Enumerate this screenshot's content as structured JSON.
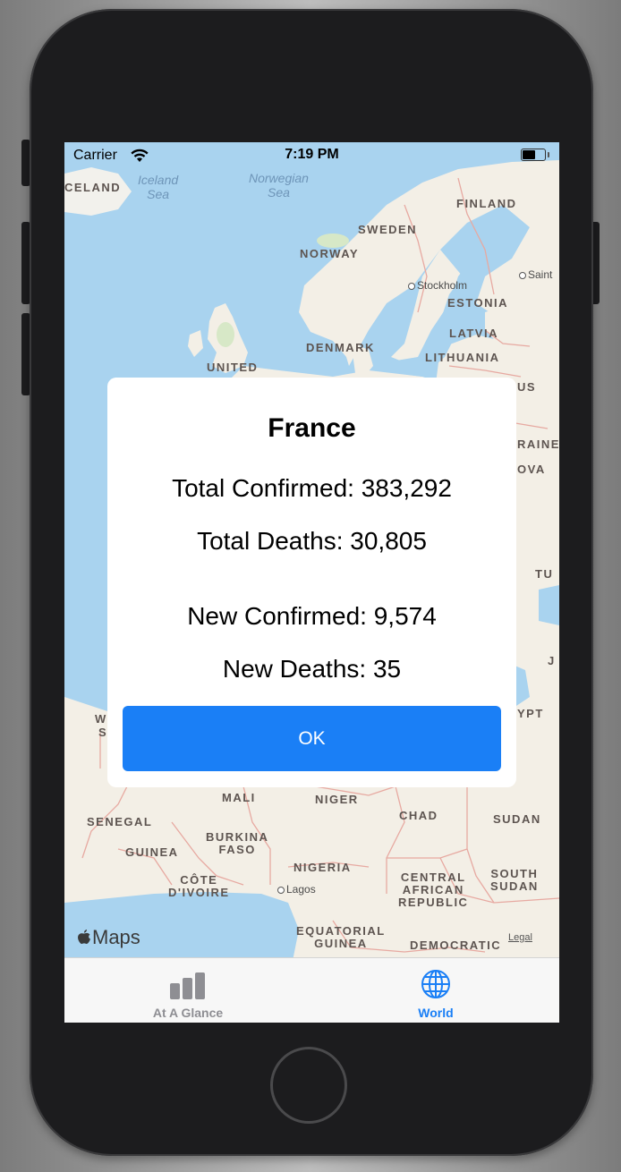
{
  "status_bar": {
    "carrier": "Carrier",
    "time": "7:19 PM"
  },
  "map": {
    "attribution": "Maps",
    "legal": "Legal",
    "labels": {
      "iceland": "CELAND",
      "finland": "FINLAND",
      "sweden": "SWEDEN",
      "norway": "NORWAY",
      "estonia": "ESTONIA",
      "latvia": "LATVIA",
      "lithuania": "LITHUANIA",
      "denmark": "DENMARK",
      "united": "UNITED",
      "us_partial": "US",
      "raine_partial": "RAINE",
      "ova_partial": "OVA",
      "tu_partial": "TU",
      "jo_partial": "J",
      "ypt_partial": "YPT",
      "w_partial": "W",
      "s_partial": "S",
      "mali": "MALI",
      "niger": "NIGER",
      "chad": "CHAD",
      "sudan": "SUDAN",
      "senegal": "SENEGAL",
      "burkina_faso": "BURKINA\nFASO",
      "guinea": "GUINEA",
      "nigeria": "NIGERIA",
      "cote_divoire": "CÔTE\nD'IVOIRE",
      "central_african_republic": "CENTRAL\nAFRICAN\nREPUBLIC",
      "south_sudan": "SOUTH\nSUDAN",
      "equatorial_guinea": "EQUATORIAL\nGUINEA",
      "democratic": "DEMOCRATIC"
    },
    "seas": {
      "iceland_sea": "Iceland\nSea",
      "norwegian_sea": "Norwegian\nSea"
    },
    "cities": {
      "stockholm": "Stockholm",
      "saint": "Saint",
      "lagos": "Lagos"
    }
  },
  "alert": {
    "title": "France",
    "total_confirmed": "Total Confirmed: 383,292",
    "total_deaths": "Total Deaths: 30,805",
    "new_confirmed": "New Confirmed: 9,574",
    "new_deaths": "New Deaths: 35",
    "ok_label": "OK"
  },
  "tabs": [
    {
      "label": "At A Glance",
      "icon": "bar-chart-icon",
      "selected": false
    },
    {
      "label": "World",
      "icon": "globe-icon",
      "selected": true
    }
  ],
  "colors": {
    "accent": "#1a7ff6",
    "water": "#a9d3ef",
    "land": "#f3efe6",
    "tab_inactive": "#8e8e93"
  }
}
